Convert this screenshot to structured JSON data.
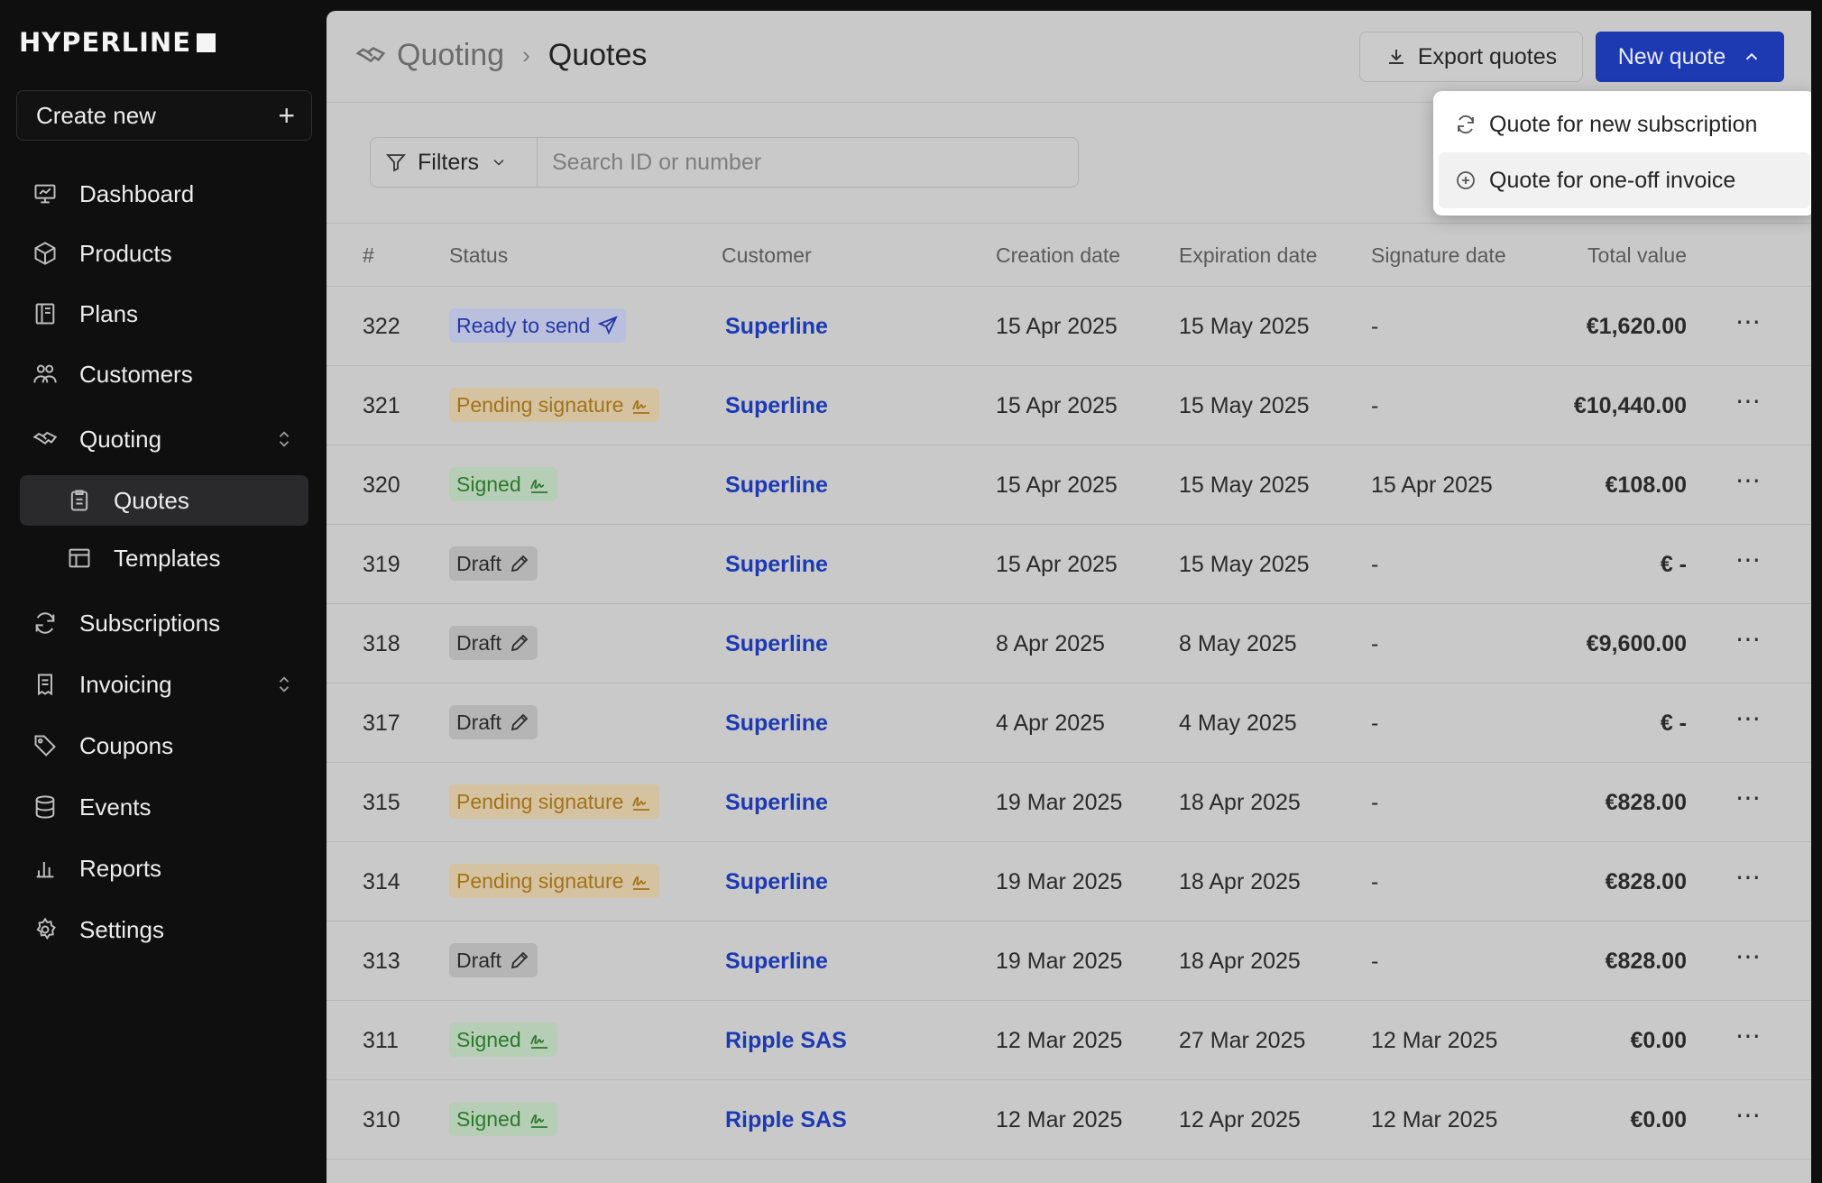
{
  "brand": "HYPERLINE",
  "sidebar": {
    "create_new": "Create new",
    "items": [
      {
        "label": "Dashboard",
        "icon": "presentation-chart-icon"
      },
      {
        "label": "Products",
        "icon": "box-icon"
      },
      {
        "label": "Plans",
        "icon": "book-icon"
      },
      {
        "label": "Customers",
        "icon": "users-icon"
      },
      {
        "label": "Quoting",
        "icon": "handshake-icon"
      },
      {
        "label": "Quotes",
        "icon": "clipboard-icon"
      },
      {
        "label": "Templates",
        "icon": "layout-icon"
      },
      {
        "label": "Subscriptions",
        "icon": "refresh-icon"
      },
      {
        "label": "Invoicing",
        "icon": "receipt-icon"
      },
      {
        "label": "Coupons",
        "icon": "tag-icon"
      },
      {
        "label": "Events",
        "icon": "database-icon"
      },
      {
        "label": "Reports",
        "icon": "bar-chart-icon"
      },
      {
        "label": "Settings",
        "icon": "gear-icon"
      }
    ]
  },
  "header": {
    "section": "Quoting",
    "page": "Quotes",
    "export_label": "Export quotes",
    "new_label": "New quote"
  },
  "dropdown": {
    "items": [
      "Quote for new subscription",
      "Quote for one-off invoice"
    ]
  },
  "toolbar": {
    "filters_label": "Filters",
    "search_placeholder": "Search ID or number"
  },
  "table": {
    "columns": [
      "#",
      "Status",
      "Customer",
      "Creation date",
      "Expiration date",
      "Signature date",
      "Total value"
    ],
    "rows": [
      {
        "num": "322",
        "status": "Ready to send",
        "kind": "ready",
        "customer": "Superline",
        "created": "15 Apr 2025",
        "expires": "15 May 2025",
        "signed": "-",
        "total": "€1,620.00"
      },
      {
        "num": "321",
        "status": "Pending signature",
        "kind": "pending",
        "customer": "Superline",
        "created": "15 Apr 2025",
        "expires": "15 May 2025",
        "signed": "-",
        "total": "€10,440.00"
      },
      {
        "num": "320",
        "status": "Signed",
        "kind": "signed",
        "customer": "Superline",
        "created": "15 Apr 2025",
        "expires": "15 May 2025",
        "signed": "15 Apr 2025",
        "total": "€108.00"
      },
      {
        "num": "319",
        "status": "Draft",
        "kind": "draft",
        "customer": "Superline",
        "created": "15 Apr 2025",
        "expires": "15 May 2025",
        "signed": "-",
        "total": "€ -"
      },
      {
        "num": "318",
        "status": "Draft",
        "kind": "draft",
        "customer": "Superline",
        "created": "8 Apr 2025",
        "expires": "8 May 2025",
        "signed": "-",
        "total": "€9,600.00"
      },
      {
        "num": "317",
        "status": "Draft",
        "kind": "draft",
        "customer": "Superline",
        "created": "4 Apr 2025",
        "expires": "4 May 2025",
        "signed": "-",
        "total": "€ -"
      },
      {
        "num": "315",
        "status": "Pending signature",
        "kind": "pending",
        "customer": "Superline",
        "created": "19 Mar 2025",
        "expires": "18 Apr 2025",
        "signed": "-",
        "total": "€828.00"
      },
      {
        "num": "314",
        "status": "Pending signature",
        "kind": "pending",
        "customer": "Superline",
        "created": "19 Mar 2025",
        "expires": "18 Apr 2025",
        "signed": "-",
        "total": "€828.00"
      },
      {
        "num": "313",
        "status": "Draft",
        "kind": "draft",
        "customer": "Superline",
        "created": "19 Mar 2025",
        "expires": "18 Apr 2025",
        "signed": "-",
        "total": "€828.00"
      },
      {
        "num": "311",
        "status": "Signed",
        "kind": "signed",
        "customer": "Ripple SAS",
        "created": "12 Mar 2025",
        "expires": "27 Mar 2025",
        "signed": "12 Mar 2025",
        "total": "€0.00"
      },
      {
        "num": "310",
        "status": "Signed",
        "kind": "signed",
        "customer": "Ripple SAS",
        "created": "12 Mar 2025",
        "expires": "12 Apr 2025",
        "signed": "12 Mar 2025",
        "total": "€0.00"
      }
    ]
  },
  "colors": {
    "accent": "#1d3ab3",
    "sidebar_bg": "#0f0f10",
    "overlay_bg": "#c9c9c9"
  }
}
